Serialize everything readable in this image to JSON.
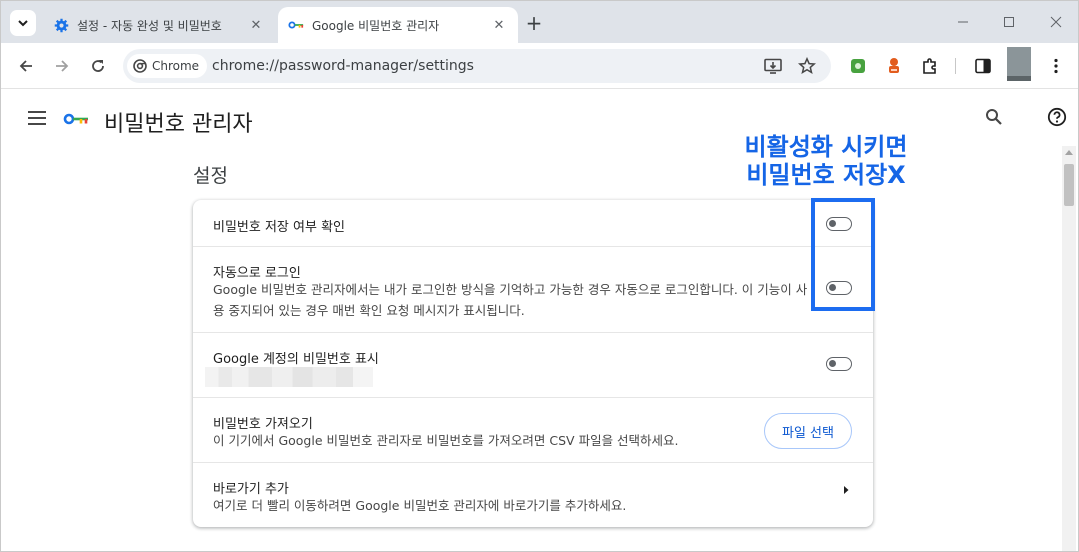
{
  "tabs": [
    {
      "title": "설정 - 자동 완성 및 비밀번호",
      "icon": "gear-icon",
      "active": false
    },
    {
      "title": "Google 비밀번호 관리자",
      "icon": "key-icon",
      "active": true
    }
  ],
  "toolbar": {
    "chip_label": "Chrome",
    "url": "chrome://password-manager/settings"
  },
  "app": {
    "title": "비밀번호 관리자"
  },
  "section": {
    "title": "설정"
  },
  "settings": {
    "offer_to_save": {
      "label": "비밀번호 저장 여부 확인",
      "enabled": false
    },
    "auto_signin": {
      "label": "자동으로 로그인",
      "description": "Google 비밀번호 관리자에서는 내가 로그인한 방식을 기억하고 가능한 경우 자동으로 로그인합니다. 이 기능이 사용 중지되어 있는 경우 매번 확인 요청 메시지가 표시됩니다.",
      "enabled": false
    },
    "show_account_passwords": {
      "label": "Google 계정의 비밀번호 표시",
      "enabled": false
    },
    "import_passwords": {
      "label": "비밀번호 가져오기",
      "description": "이 기기에서 Google 비밀번호 관리자로 비밀번호를 가져오려면 CSV 파일을 선택하세요.",
      "button_label": "파일 선택"
    },
    "add_shortcut": {
      "label": "바로가기 추가",
      "description": "여기로 더 빨리 이동하려면 Google 비밀번호 관리자에 바로가기를 추가하세요."
    }
  },
  "annotation": {
    "line1": "비활성화 시키면",
    "line2": "비밀번호 저장X",
    "color": "#1565e6"
  }
}
